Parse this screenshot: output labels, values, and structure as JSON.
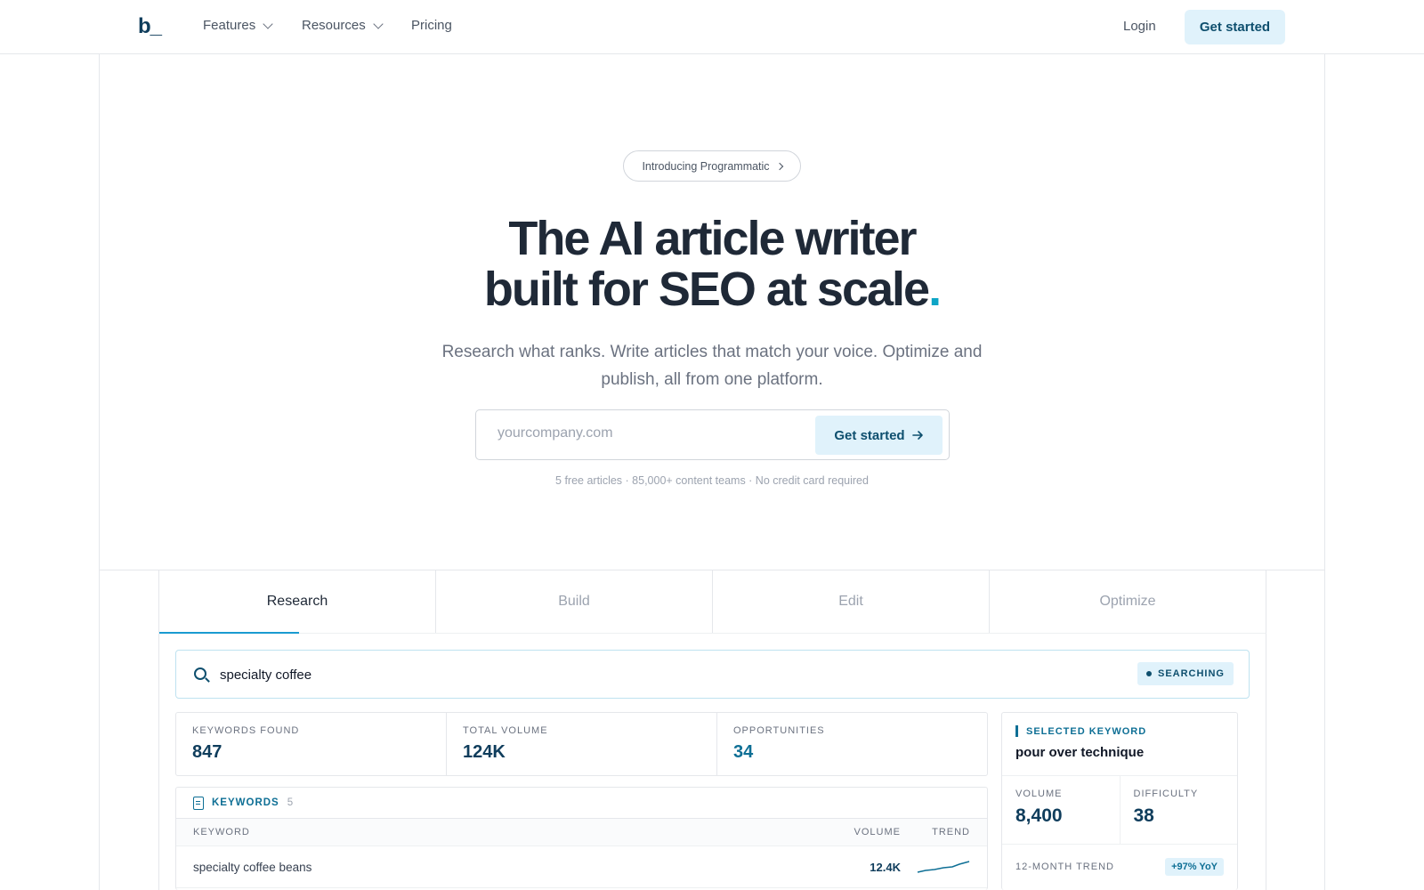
{
  "nav": {
    "logo": "b_",
    "items": [
      "Features",
      "Resources",
      "Pricing"
    ],
    "login": "Login",
    "cta": "Get started"
  },
  "hero": {
    "pill": "Introducing Programmatic",
    "headline_line1": "The AI article writer",
    "headline_line2": "built for SEO at scale",
    "headline_dot": ".",
    "subheading": "Research what ranks. Write articles that match your voice. Optimize and publish, all from one platform.",
    "email_placeholder": "yourcompany.com",
    "email_button": "Get started",
    "note": "5 free articles · 85,000+ content teams · No credit card required"
  },
  "tabs": [
    "Research",
    "Build",
    "Edit",
    "Optimize"
  ],
  "active_tab": "Research",
  "search": {
    "query": "specialty coffee",
    "status": "SEARCHING"
  },
  "stats": [
    {
      "label": "KEYWORDS FOUND",
      "value": "847"
    },
    {
      "label": "TOTAL VOLUME",
      "value": "124K"
    },
    {
      "label": "OPPORTUNITIES",
      "value": "34"
    }
  ],
  "keywords": {
    "title": "KEYWORDS",
    "count": "5",
    "columns": [
      "KEYWORD",
      "VOLUME",
      "TREND"
    ],
    "rows": [
      {
        "keyword": "specialty coffee beans",
        "volume": "12.4K"
      }
    ]
  },
  "selected": {
    "label": "SELECTED KEYWORD",
    "keyword": "pour over technique",
    "volume_label": "VOLUME",
    "volume": "8,400",
    "difficulty_label": "DIFFICULTY",
    "difficulty": "38",
    "trend_label": "12-MONTH TREND",
    "yoy": "+97% YoY"
  },
  "colors": {
    "accent": "#0ea5c6",
    "primary_dark": "#0f3d5c",
    "button_bg": "#e0f2fb"
  }
}
